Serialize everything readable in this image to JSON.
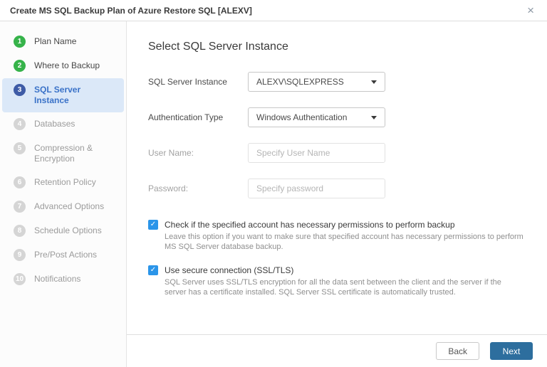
{
  "window": {
    "title": "Create MS SQL Backup Plan of Azure Restore SQL [ALEXV]",
    "close_icon": "×"
  },
  "sidebar": {
    "steps": [
      {
        "num": "1",
        "label": "Plan Name",
        "state": "completed"
      },
      {
        "num": "2",
        "label": "Where to Backup",
        "state": "completed"
      },
      {
        "num": "3",
        "label": "SQL Server Instance",
        "state": "active"
      },
      {
        "num": "4",
        "label": "Databases",
        "state": "pending"
      },
      {
        "num": "5",
        "label": "Compression & Encryption",
        "state": "pending"
      },
      {
        "num": "6",
        "label": "Retention Policy",
        "state": "pending"
      },
      {
        "num": "7",
        "label": "Advanced Options",
        "state": "pending"
      },
      {
        "num": "8",
        "label": "Schedule Options",
        "state": "pending"
      },
      {
        "num": "9",
        "label": "Pre/Post Actions",
        "state": "pending"
      },
      {
        "num": "10",
        "label": "Notifications",
        "state": "pending"
      }
    ]
  },
  "main": {
    "heading": "Select SQL Server Instance",
    "fields": [
      {
        "label": "SQL Server Instance",
        "type": "select",
        "value": "ALEXV\\SQLEXPRESS"
      },
      {
        "label": "Authentication Type",
        "type": "select",
        "value": "Windows Authentication"
      },
      {
        "label": "User Name:",
        "type": "input",
        "placeholder": "Specify User Name",
        "disabled": true
      },
      {
        "label": "Password:",
        "type": "input",
        "placeholder": "Specify password",
        "disabled": true
      }
    ],
    "checkboxes": [
      {
        "checked": true,
        "check_glyph": "✓",
        "label": "Check if the specified account has necessary permissions to perform backup",
        "description": "Leave this option if you want to make sure that specified account has necessary permissions to perform MS SQL Server database backup."
      },
      {
        "checked": true,
        "check_glyph": "✓",
        "label": "Use secure connection (SSL/TLS)",
        "description": "SQL Server uses SSL/TLS encryption for all the data sent between the client and the server if the server has a certificate installed. SQL Server SSL certificate is automatically trusted."
      }
    ]
  },
  "footer": {
    "back_label": "Back",
    "next_label": "Next"
  },
  "colors": {
    "accent_blue": "#2d6e9e",
    "checkbox_blue": "#2b95e9",
    "step_completed_green": "#36b34a",
    "step_active_circle": "#3e5ba6",
    "step_active_bg": "#dbe8f8",
    "step_active_text": "#3a72c8"
  }
}
